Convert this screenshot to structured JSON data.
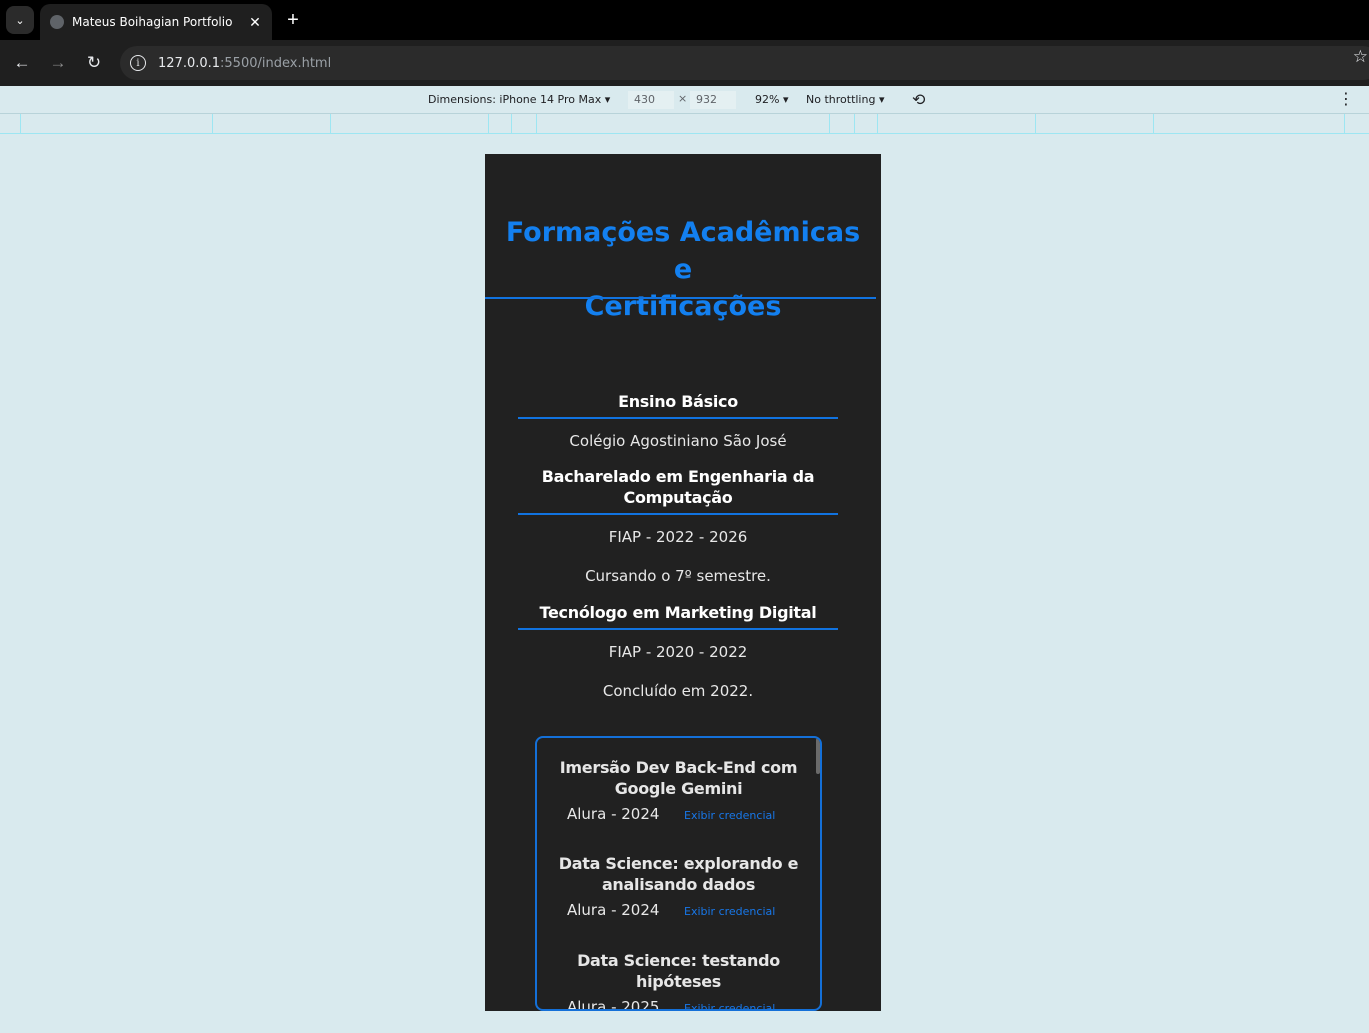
{
  "browser": {
    "tab_title": "Mateus Boihagian Portfolio",
    "url_host": "127.0.0.1",
    "url_path": ":5500/index.html"
  },
  "devtools": {
    "dimensions_label": "Dimensions: iPhone 14 Pro Max",
    "width": "430",
    "times": "×",
    "height": "932",
    "zoom": "92%",
    "throttling": "No throttling"
  },
  "page": {
    "title_line1": "Formações Acadêmicas e",
    "title_line2": "Certificações",
    "education": [
      {
        "heading": "Ensino Básico",
        "lines": [
          "Colégio Agostiniano São José"
        ]
      },
      {
        "heading": "Bacharelado em Engenharia da Computação",
        "lines": [
          "FIAP - 2022 - 2026",
          "Cursando o 7º semestre."
        ]
      },
      {
        "heading": "Tecnólogo em Marketing Digital",
        "lines": [
          "FIAP - 2020 - 2022",
          "Concluído em 2022."
        ]
      }
    ],
    "certificates": [
      {
        "title": "Imersão Dev Back-End com Google Gemini",
        "issuer": "Alura - 2024",
        "link": "Exibir credencial"
      },
      {
        "title": "Data Science: explorando e analisando dados",
        "issuer": "Alura - 2024",
        "link": "Exibir credencial"
      },
      {
        "title": "Data Science: testando hipóteses",
        "issuer": "Alura - 2025",
        "link": "Exibir credencial"
      }
    ]
  }
}
